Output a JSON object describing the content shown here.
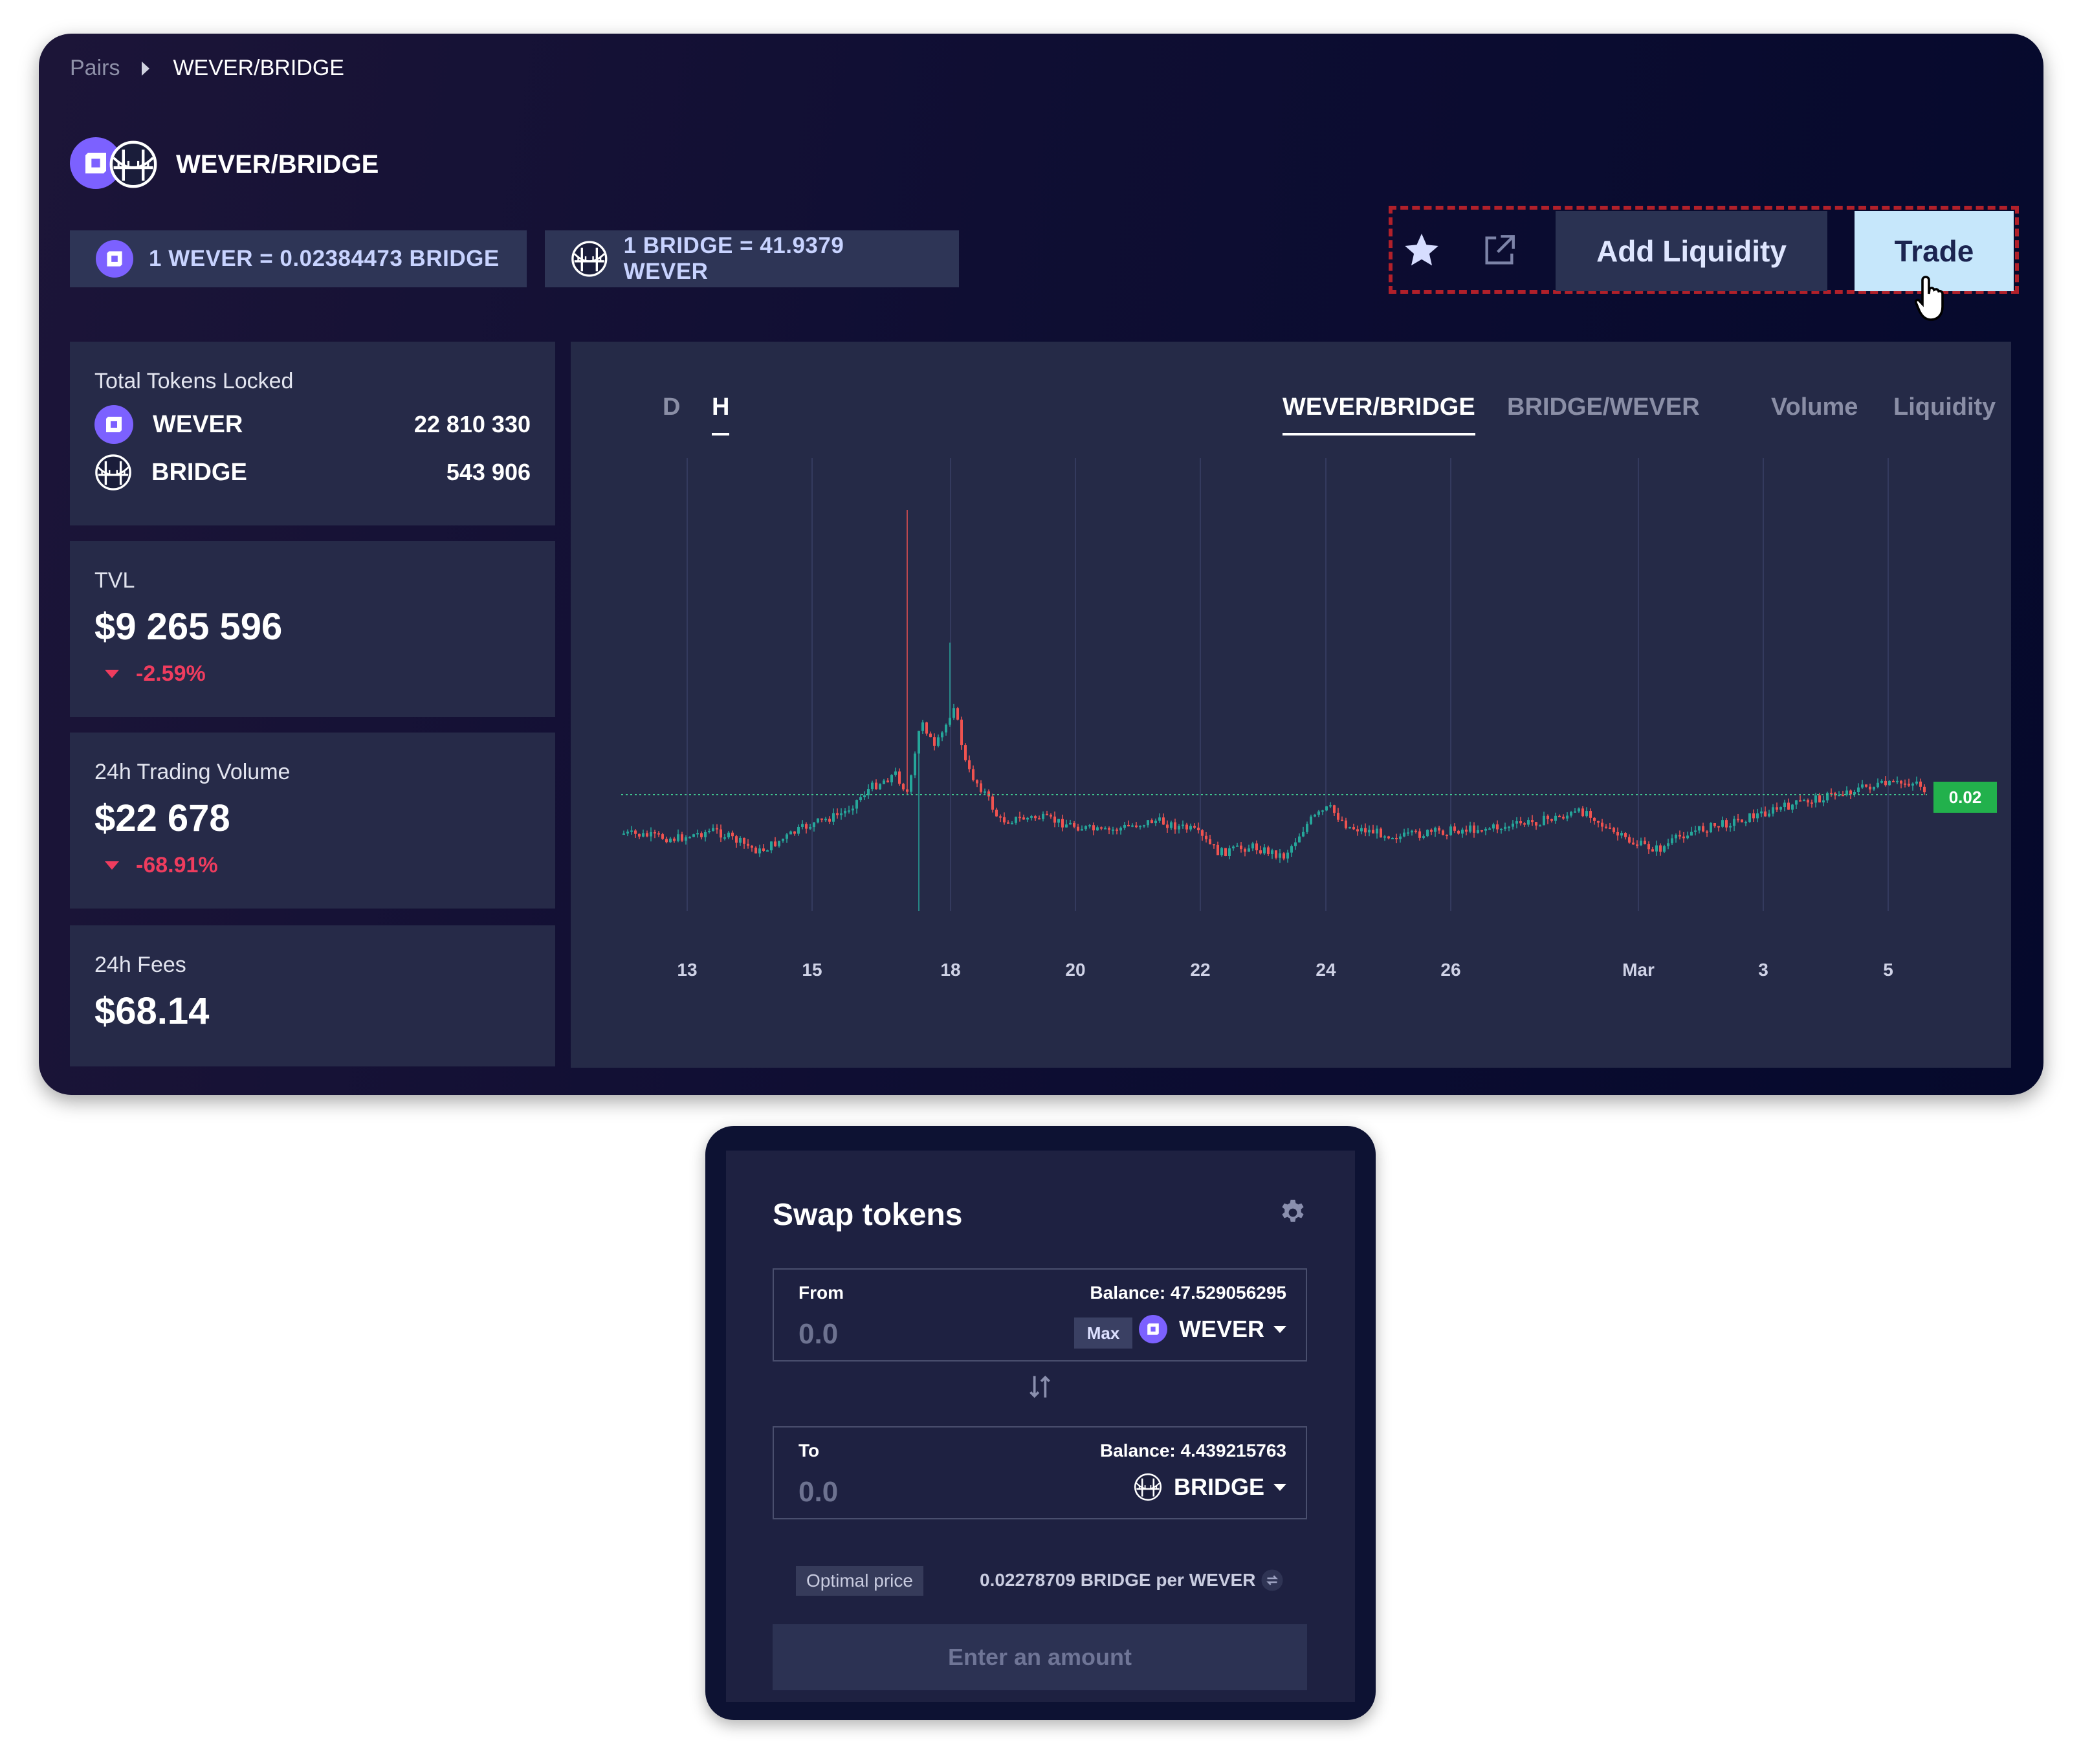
{
  "breadcrumb": {
    "root": "Pairs",
    "current": "WEVER/BRIDGE"
  },
  "pair": {
    "title": "WEVER/BRIDGE"
  },
  "rates": {
    "wever_to_bridge": "1 WEVER = 0.02384473 BRIDGE",
    "bridge_to_wever": "1 BRIDGE = 41.9379 WEVER"
  },
  "actions": {
    "add_liquidity": "Add Liquidity",
    "trade": "Trade"
  },
  "stats": {
    "tokens_locked": {
      "label": "Total Tokens Locked",
      "tokens": [
        {
          "name": "WEVER",
          "amount": "22 810 330"
        },
        {
          "name": "BRIDGE",
          "amount": "543 906"
        }
      ]
    },
    "tvl": {
      "label": "TVL",
      "value": "$9 265 596",
      "change": "-2.59%"
    },
    "volume": {
      "label": "24h Trading Volume",
      "value": "$22 678",
      "change": "-68.91%"
    },
    "fees": {
      "label": "24h Fees",
      "value": "$68.14"
    }
  },
  "chart": {
    "timeframes": [
      "D",
      "H"
    ],
    "active_timeframe": "H",
    "views": [
      "WEVER/BRIDGE",
      "BRIDGE/WEVER",
      "Volume",
      "Liquidity"
    ],
    "active_view": "WEVER/BRIDGE",
    "last_price_label": "0.02"
  },
  "chart_data": {
    "type": "candlestick",
    "title": "",
    "x_ticks": [
      "13",
      "15",
      "18",
      "20",
      "22",
      "24",
      "26",
      "Mar",
      "3",
      "5"
    ],
    "last_value": 0.02,
    "grid": "vertical",
    "colors": {
      "up": "#26a69a",
      "down": "#ef5350",
      "last_price": "#22b14c"
    }
  },
  "swap": {
    "title": "Swap tokens",
    "from": {
      "label": "From",
      "balance": "Balance: 47.529056295",
      "placeholder": "0.0",
      "max": "Max",
      "token": "WEVER"
    },
    "to": {
      "label": "To",
      "balance": "Balance: 4.439215763",
      "placeholder": "0.0",
      "token": "BRIDGE"
    },
    "optimal_label": "Optimal price",
    "price": "0.02278709 BRIDGE per WEVER",
    "submit": "Enter an amount"
  },
  "icons": {
    "wever": "wever-icon",
    "bridge": "bridge-icon",
    "star": "star-icon",
    "external": "external-link-icon",
    "gear": "gear-icon",
    "swap": "swap-arrows-icon",
    "refresh": "refresh-icon",
    "cursor": "hand-cursor-icon"
  },
  "theme": {
    "accent": "#7b61ff",
    "negative": "#ef3c5e",
    "trade_button": "#c6e7fb"
  }
}
